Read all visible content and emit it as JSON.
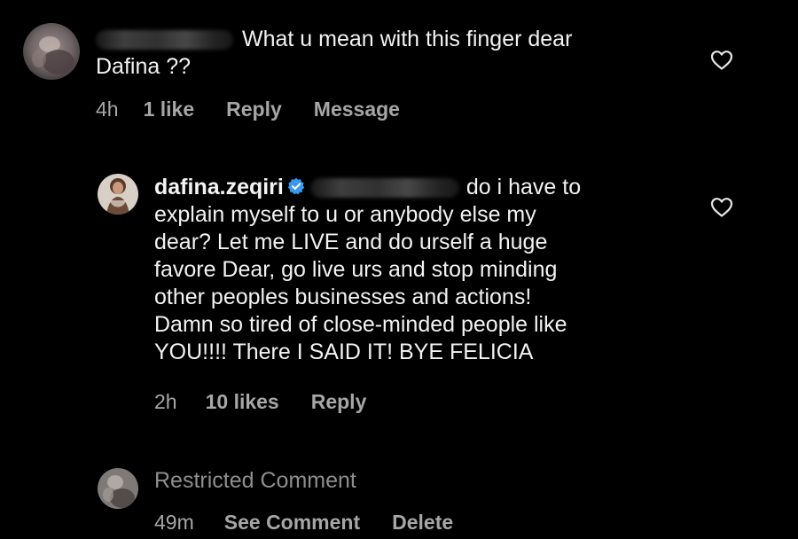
{
  "comments": [
    {
      "mention_blurred": true,
      "text_line1": "What u mean with this finger dear",
      "text_line2": "Dafina ??",
      "time": "4h",
      "likes": "1 like",
      "reply": "Reply",
      "message": "Message"
    },
    {
      "username": "dafina.zeqiri",
      "verified": true,
      "mention_blurred": true,
      "lines": [
        "do i have to",
        "explain myself to u or anybody else my",
        "dear? Let me LIVE and do urself a huge",
        "favore Dear, go live urs and stop minding",
        "other peoples businesses and actions!",
        "Damn so tired of close-minded people like",
        "YOU!!!! There I SAID IT! BYE FELICIA"
      ],
      "time": "2h",
      "likes": "10 likes",
      "reply": "Reply"
    },
    {
      "restricted_label": "Restricted Comment",
      "time": "49m",
      "see_comment": "See Comment",
      "delete": "Delete"
    }
  ],
  "colors": {
    "background": "#000000",
    "text": "#f2f2f2",
    "meta": "#a6a6a6",
    "restricted": "#8e8e8e",
    "verified_badge": "#3897f0"
  },
  "icons": [
    "avatar",
    "verified-badge-icon",
    "heart-icon"
  ]
}
